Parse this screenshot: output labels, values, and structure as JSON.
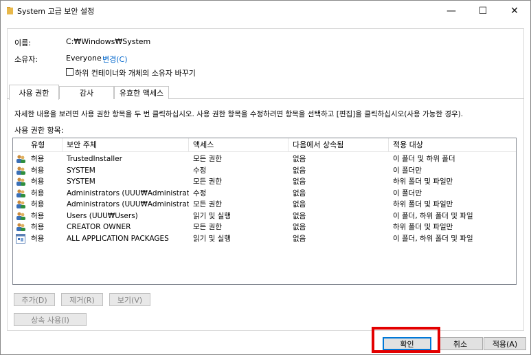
{
  "window": {
    "title": "System 고급 보안 설정",
    "minimize_symbol": "—",
    "maximize_symbol": "☐",
    "close_symbol": "✕"
  },
  "info": {
    "name_label": "이름:",
    "name_value": "C:₩Windows₩System",
    "owner_label": "소유자:",
    "owner_value": "Everyone",
    "change_link": "변경(C)",
    "replace_owner_label": "하위 컨테이너와 개체의 소유자 바꾸기"
  },
  "tabs": [
    {
      "label": "사용 권한"
    },
    {
      "label": "감사"
    },
    {
      "label": "유효한 액세스"
    }
  ],
  "instructions": "자세한 내용을 보려면 사용 권한 항목을 두 번 클릭하십시오. 사용 권한 항목을 수정하려면 항목을 선택하고 [편집]을 클릭하십시오(사용 가능한 경우).",
  "entries_label": "사용 권한 항목:",
  "table": {
    "columns": [
      "유형",
      "보안 주체",
      "액세스",
      "다음에서 상속됨",
      "적용 대상"
    ],
    "rows": [
      {
        "icon": "users-icon",
        "type": "허용",
        "principal": "TrustedInstaller",
        "access": "모든 권한",
        "inherited": "없음",
        "applies": "이 폴더 및 하위 폴더"
      },
      {
        "icon": "users-icon",
        "type": "허용",
        "principal": "SYSTEM",
        "access": "수정",
        "inherited": "없음",
        "applies": "이 폴더만"
      },
      {
        "icon": "users-icon",
        "type": "허용",
        "principal": "SYSTEM",
        "access": "모든 권한",
        "inherited": "없음",
        "applies": "하위 폴더 및 파일만"
      },
      {
        "icon": "users-icon",
        "type": "허용",
        "principal": "Administrators (UUU₩Administrato...",
        "access": "수정",
        "inherited": "없음",
        "applies": "이 폴더만"
      },
      {
        "icon": "users-icon",
        "type": "허용",
        "principal": "Administrators (UUU₩Administrato...",
        "access": "모든 권한",
        "inherited": "없음",
        "applies": "하위 폴더 및 파일만"
      },
      {
        "icon": "users-icon",
        "type": "허용",
        "principal": "Users (UUU₩Users)",
        "access": "읽기 및 실행",
        "inherited": "없음",
        "applies": "이 폴더, 하위 폴더 및 파일"
      },
      {
        "icon": "users-icon",
        "type": "허용",
        "principal": "CREATOR OWNER",
        "access": "모든 권한",
        "inherited": "없음",
        "applies": "하위 폴더 및 파일만"
      },
      {
        "icon": "app-packages-icon",
        "type": "허용",
        "principal": "ALL APPLICATION PACKAGES",
        "access": "읽기 및 실행",
        "inherited": "없음",
        "applies": "이 폴더, 하위 폴더 및 파일"
      }
    ]
  },
  "buttons": {
    "add": "추가(D)",
    "remove": "제거(R)",
    "view": "보기(V)",
    "enable_inheritance": "상속 사용(I)",
    "ok": "확인",
    "cancel": "취소",
    "apply": "적용(A)"
  },
  "colors": {
    "link": "#0066cc",
    "highlight": "#e30000",
    "default_button_border": "#0078d7"
  }
}
